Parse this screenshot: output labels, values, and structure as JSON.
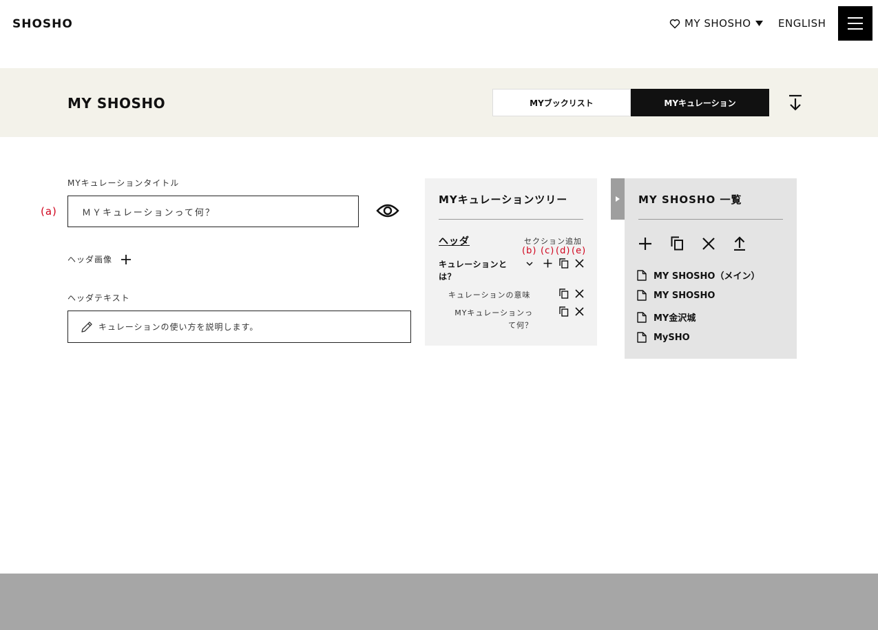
{
  "header": {
    "logo": "SHOSHO",
    "my_shosho": "MY SHOSHO",
    "english": "ENGLISH"
  },
  "band": {
    "title": "MY SHOSHO",
    "tabs": [
      {
        "label": "MYブックリスト",
        "active": false
      },
      {
        "label": "MYキュレーション",
        "active": true
      }
    ]
  },
  "form": {
    "title_label": "MYキュレーションタイトル",
    "marker_a": "(a)",
    "title_value": "ＭＹキュレーションって何？",
    "header_image_label": "ヘッダ画像",
    "header_text_label": "ヘッダテキスト",
    "header_text_value": "キュレーションの使い方を説明します。"
  },
  "tree": {
    "title": "MYキュレーションツリー",
    "header_link": "ヘッダ",
    "add_section": "セクション追加",
    "markers": [
      "(b)",
      "(c)",
      "(d)",
      "(e)"
    ],
    "section_1": "キュレーションとは？",
    "sub_1": "キュレーションの意味",
    "sub_2": "MYキュレーションって何？"
  },
  "list": {
    "title": "MY SHOSHO 一覧",
    "items": [
      "MY SHOSHO（メイン）",
      "MY SHOSHO",
      "MY金沢城",
      "MySHO"
    ]
  },
  "colors": {
    "accent_red": "#d0021b",
    "band_beige": "#f3f2ea",
    "dark": "#111111",
    "footer_gray": "#a6a6a6"
  }
}
